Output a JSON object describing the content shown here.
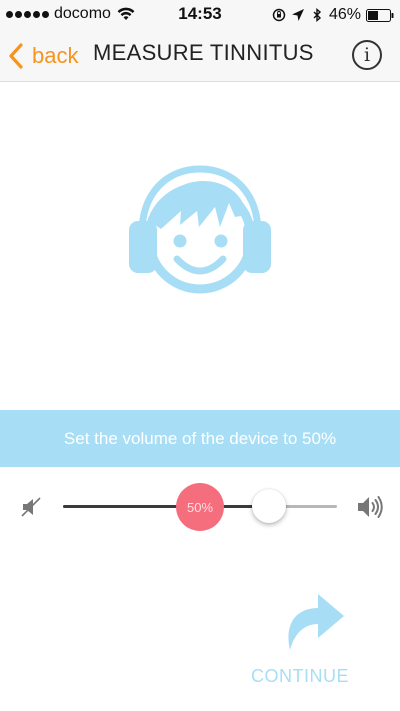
{
  "status_bar": {
    "carrier": "docomo",
    "time": "14:53",
    "battery": "46%",
    "icons": [
      "signal-dots-icon",
      "wifi-icon",
      "orientation-lock-icon",
      "location-arrow-icon",
      "bluetooth-icon",
      "battery-icon"
    ]
  },
  "nav": {
    "back_label": "back",
    "title": "MEASURE TINNITUS",
    "info_label": "i"
  },
  "instruction": "Set the volume of the device to 50%",
  "volume": {
    "target_label": "50%",
    "level": 0.75,
    "target": 0.5
  },
  "continue_label": "CONTINUE",
  "colors": {
    "accent_orange": "#f7941d",
    "light_blue": "#a7def5",
    "target_red": "#f56e7e"
  }
}
